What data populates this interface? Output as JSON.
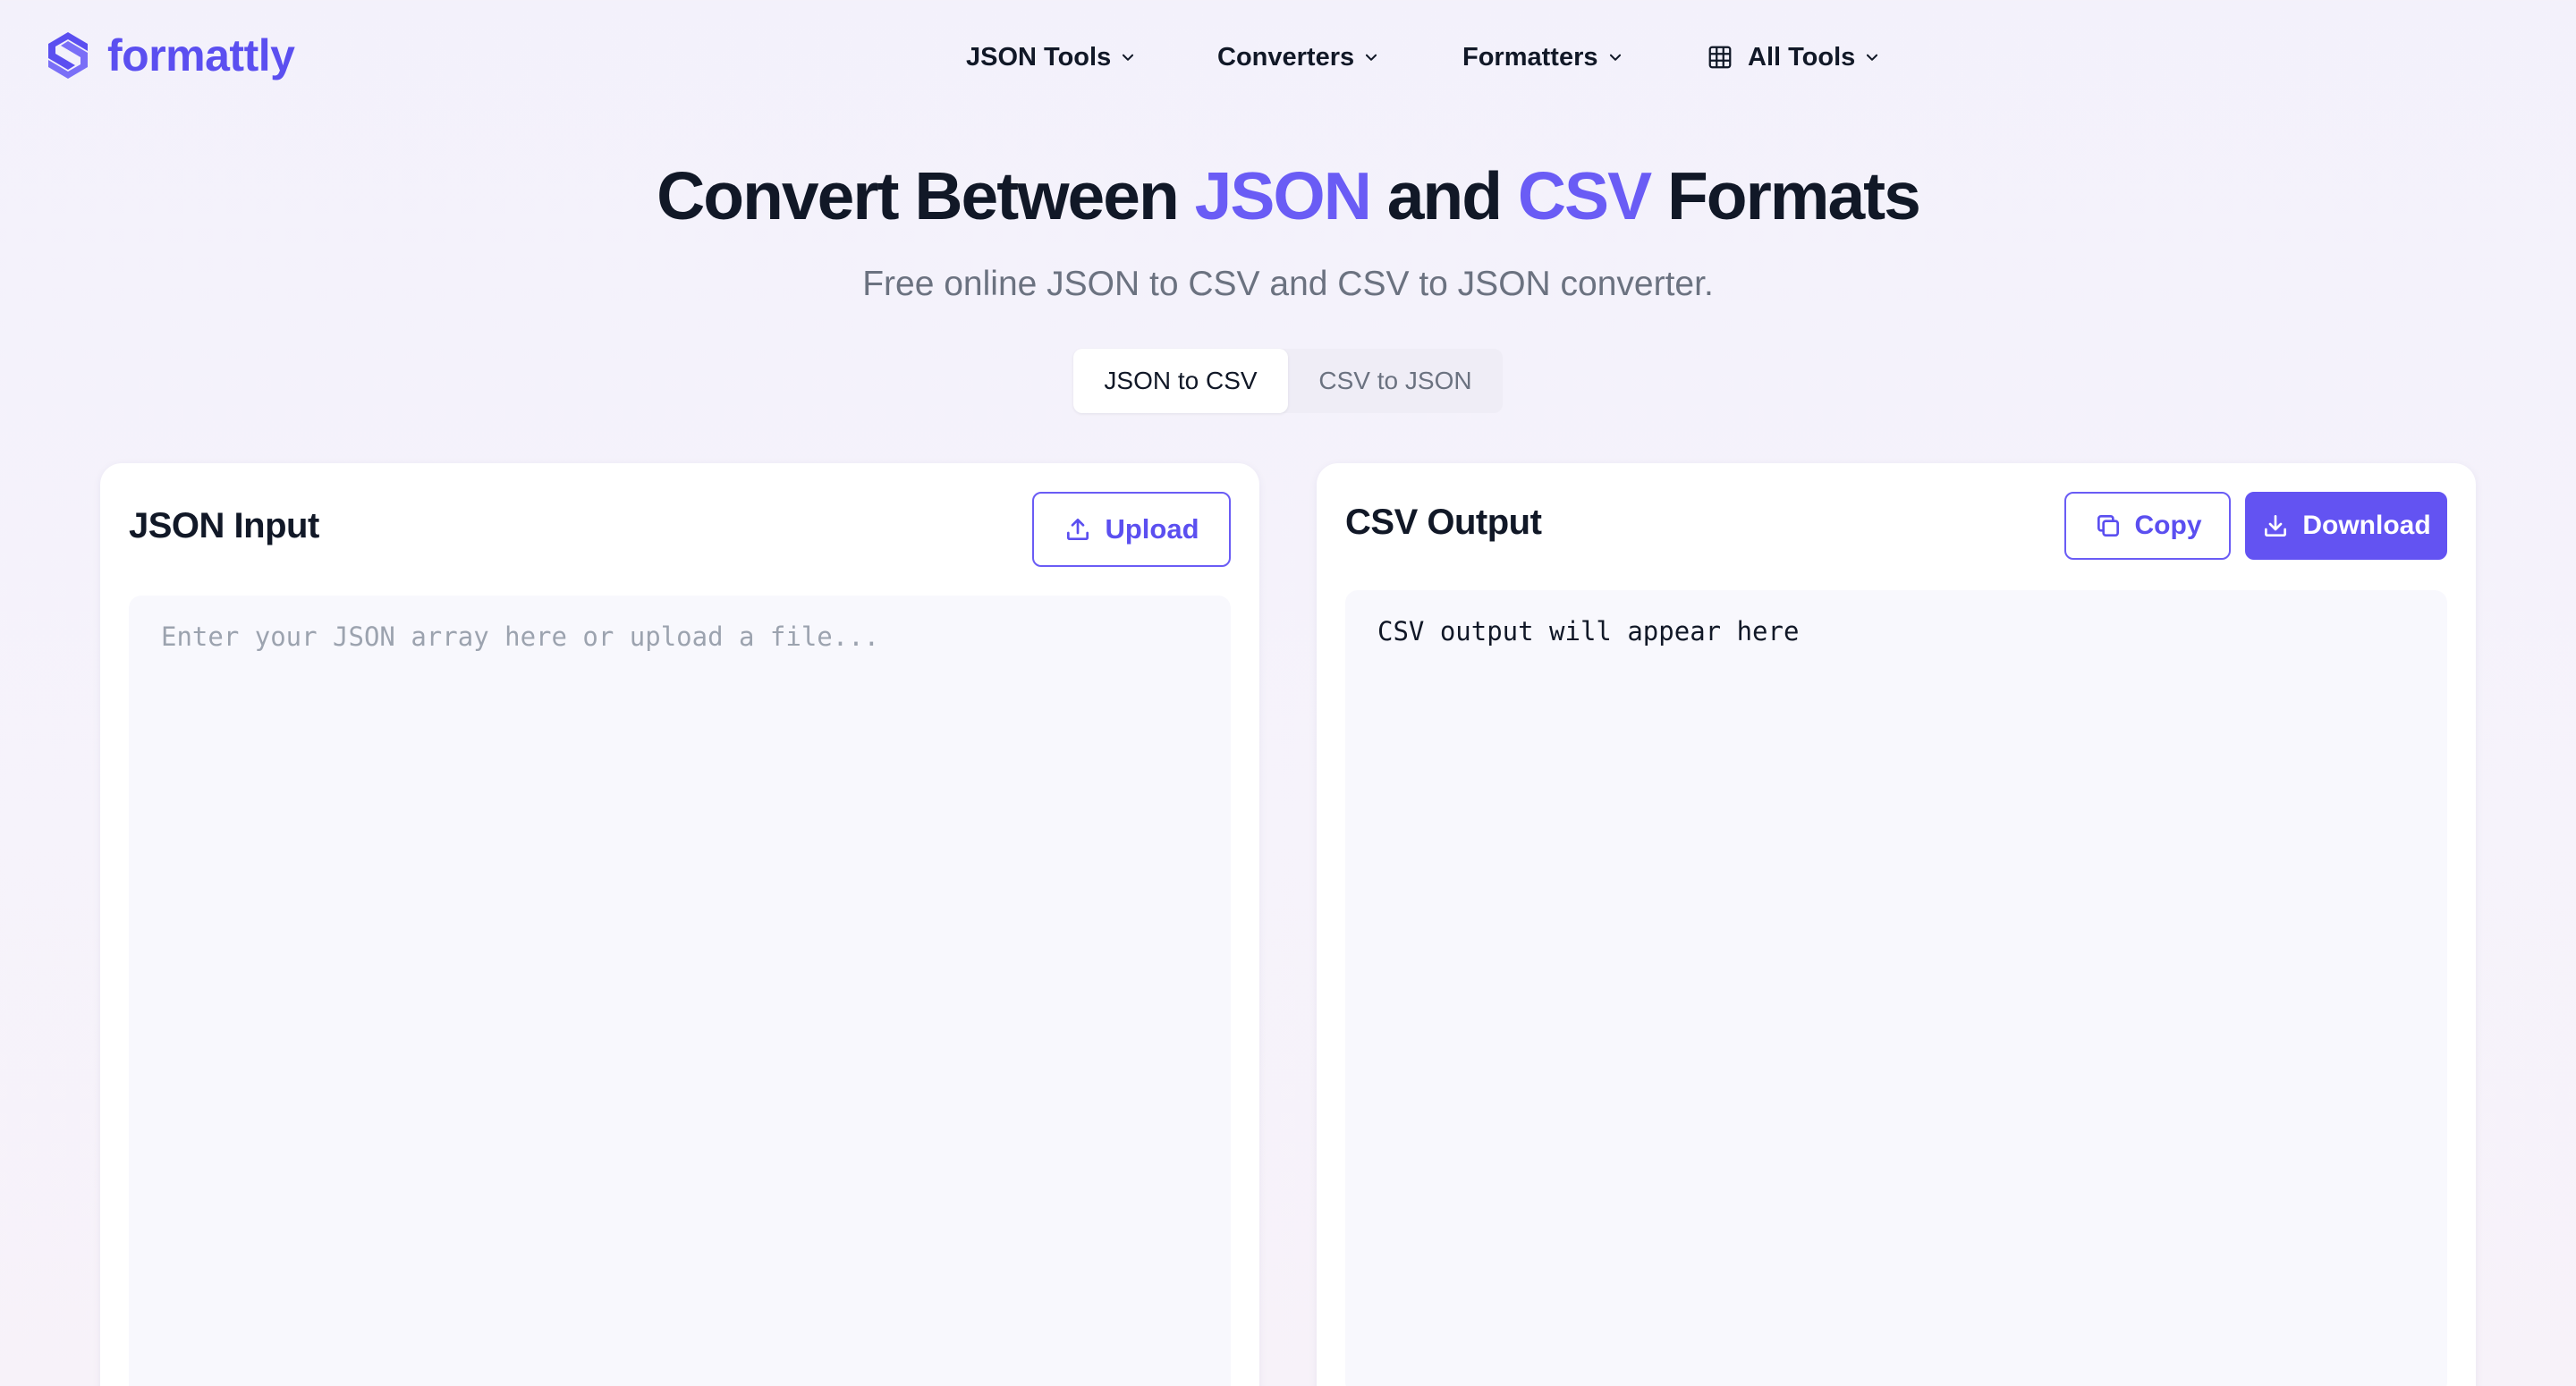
{
  "brand": {
    "name": "formattly",
    "color": "#5b4ff0"
  },
  "nav": {
    "items": [
      {
        "label": "JSON Tools",
        "icon": "chevron-down-icon"
      },
      {
        "label": "Converters",
        "icon": "chevron-down-icon"
      },
      {
        "label": "Formatters",
        "icon": "chevron-down-icon"
      },
      {
        "label": "All Tools",
        "icon": "grid-icon"
      }
    ]
  },
  "hero": {
    "title_part1": "Convert Between ",
    "title_accent1": "JSON",
    "title_part2": " and ",
    "title_accent2": "CSV",
    "title_part3": " Formats",
    "subtitle": "Free online JSON to CSV and CSV to JSON converter.",
    "accent_color": "#6a5cf5"
  },
  "tabs": [
    {
      "label": "JSON to CSV",
      "active": true
    },
    {
      "label": "CSV to JSON",
      "active": false
    }
  ],
  "input_panel": {
    "title": "JSON Input",
    "upload_label": "Upload",
    "upload_icon": "upload-icon",
    "placeholder": "Enter your JSON array here or upload a file...",
    "value": ""
  },
  "output_panel": {
    "title": "CSV Output",
    "copy_label": "Copy",
    "copy_icon": "copy-icon",
    "download_label": "Download",
    "download_icon": "download-icon",
    "output_text": "CSV output will appear here"
  }
}
